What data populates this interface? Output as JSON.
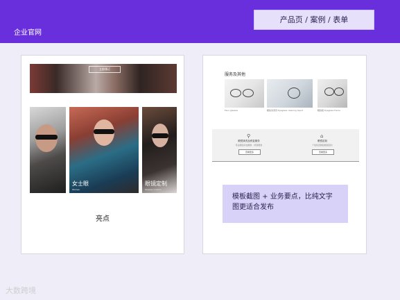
{
  "header": {
    "brand": "企业官网",
    "breadcrumb": "产品页 / 案例 / 表单"
  },
  "left_card": {
    "hero_button": "立即预订",
    "portraits": [
      {
        "caption": "",
        "sub": ""
      },
      {
        "caption": "女士眼",
        "sub": "Women"
      },
      {
        "caption": "眼镜定制",
        "sub": "Glasses custom"
      }
    ],
    "label": "亮点"
  },
  "right_card": {
    "section_title": "服务及其他",
    "thumb_captions": [
      "Faux glasses",
      "眼镜清洗剂 Eyeglass cleaning liquid",
      "眼镜框 Eyeglass frame"
    ],
    "services": [
      {
        "name": "眼镜清洗及修复服务",
        "desc": "专业眼镜清洁服务 · 修复服务",
        "button": "查看更多"
      },
      {
        "name": "眼镜定制",
        "desc": "个性化定制镜框和镜片",
        "button": "查看更多"
      }
    ]
  },
  "note": "模板截图 + 业务要点，比纯文字图更适合发布",
  "watermark": "大数跨境",
  "colors": {
    "header": "#6a2fdd",
    "note_bg": "#d9d2f8",
    "page_bg": "#eeedf8"
  }
}
